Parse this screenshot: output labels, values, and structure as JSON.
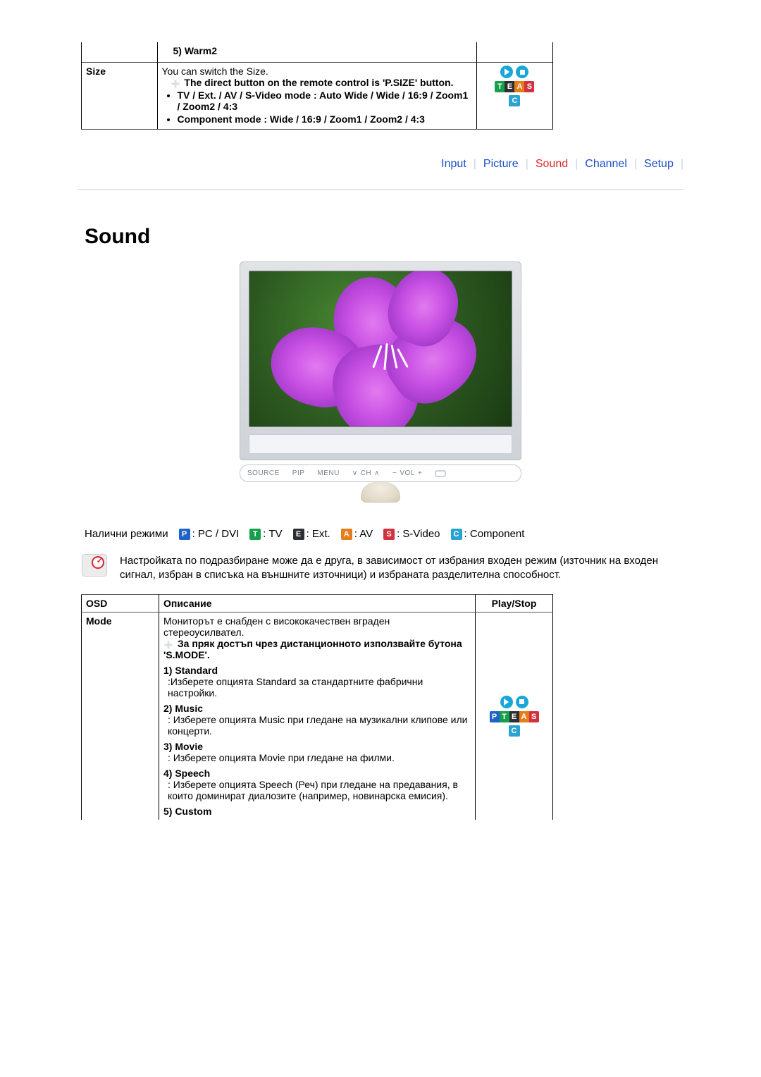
{
  "top_table": {
    "warm_row": "5) Warm2",
    "size_label": "Size",
    "size_intro": "You can switch the Size.",
    "size_note": "The direct button on the remote control is 'P.SIZE' button.",
    "bullet1": "TV / Ext. / AV / S-Video mode : Auto Wide / Wide / 16:9 / Zoom1 / Zoom2 / 4:3",
    "bullet2": "Component mode : Wide / 16:9 / Zoom1 / Zoom2 / 4:3"
  },
  "tabs": {
    "input": "Input",
    "picture": "Picture",
    "sound": "Sound",
    "channel": "Channel",
    "setup": "Setup"
  },
  "heading": "Sound",
  "monitor_buttons": {
    "source": "SOURCE",
    "pip": "PIP",
    "menu": "MENU",
    "ch": "CH",
    "vol": "VOL"
  },
  "modes_label": "Налични режими",
  "modes": {
    "p": ": PC / DVI",
    "t": ": TV",
    "e": ": Ext.",
    "a": ": AV",
    "s": ": S-Video",
    "c": ": Component"
  },
  "tip_text": "Настройката по подразбиране може да е друга, в зависимост от избрания входен режим (източник на входен сигнал, избран в списъка на външните източници) и избраната разделителна способност.",
  "mode_table": {
    "osd": "OSD",
    "desc": "Описание",
    "playstop": "Play/Stop",
    "mode_label": "Mode",
    "mode_intro": "Мониторът е снабден с висококачествен вграден стереоусилвател.",
    "mode_note": "За пряк достъп чрез дистанционното използвайте бутона 'S.MODE'.",
    "opt1_t": "1) Standard",
    "opt1_d": ":Изберете опцията Standard за стандартните фабрични настройки.",
    "opt2_t": "2) Music",
    "opt2_d": ": Изберете опцията Music при гледане на музикални клипове или концерти.",
    "opt3_t": "3) Movie",
    "opt3_d": ": Изберете опцията Movie при гледане на филми.",
    "opt4_t": "4) Speech",
    "opt4_d": ": Изберете опцията Speech (Реч) при гледане на предавания, в които доминират диалозите (например, новинарска емисия).",
    "opt5_t": "5) Custom"
  }
}
